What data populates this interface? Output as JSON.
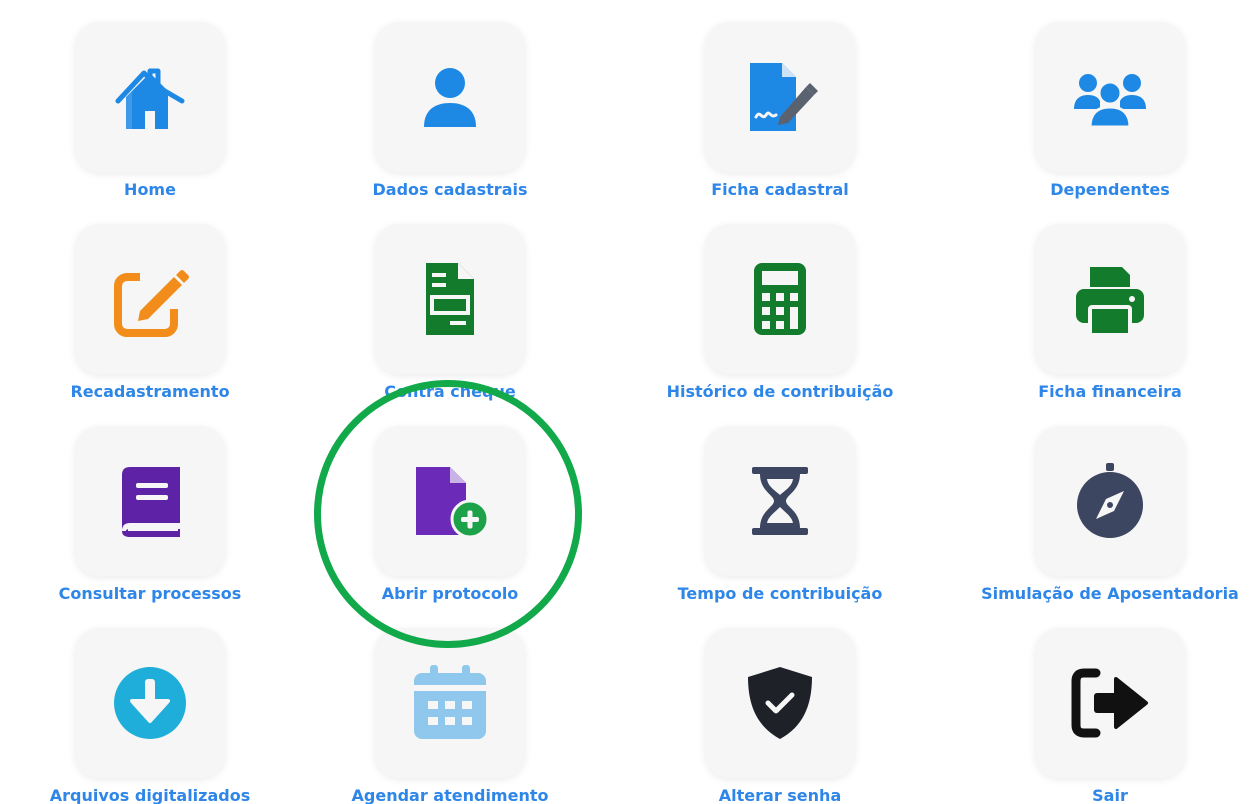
{
  "menu": {
    "items": [
      {
        "label": "Home",
        "icon": "home-icon",
        "color": "#1e88e5"
      },
      {
        "label": "Dados cadastrais",
        "icon": "user-icon",
        "color": "#1e88e5"
      },
      {
        "label": "Ficha cadastral",
        "icon": "document-signature-icon",
        "color": "#1e88e5"
      },
      {
        "label": "Dependentes",
        "icon": "users-group-icon",
        "color": "#1e88e5"
      },
      {
        "label": "Recadastramento",
        "icon": "edit-icon",
        "color": "#f28c1a"
      },
      {
        "label": "Contra cheque",
        "icon": "file-invoice-icon",
        "color": "#137c2c"
      },
      {
        "label": "Histórico de contribuição",
        "icon": "calculator-icon",
        "color": "#137c2c"
      },
      {
        "label": "Ficha financeira",
        "icon": "printer-icon",
        "color": "#137c2c"
      },
      {
        "label": "Consultar processos",
        "icon": "book-icon",
        "color": "#5e22a6"
      },
      {
        "label": "Abrir protocolo",
        "icon": "file-add-icon",
        "color": "#6c2ab8"
      },
      {
        "label": "Tempo de contribuição",
        "icon": "hourglass-icon",
        "color": "#3d4660"
      },
      {
        "label": "Simulação de Aposentadoria",
        "icon": "compass-icon",
        "color": "#3d4660"
      },
      {
        "label": "Arquivos digitalizados",
        "icon": "download-circle-icon",
        "color": "#1eaed9"
      },
      {
        "label": "Agendar atendimento",
        "icon": "calendar-icon",
        "color": "#8fc8ec"
      },
      {
        "label": "Alterar senha",
        "icon": "shield-check-icon",
        "color": "#1e2128"
      },
      {
        "label": "Sair",
        "icon": "sign-out-icon",
        "color": "#111111"
      }
    ]
  },
  "highlight": {
    "target": "Abrir protocolo",
    "color": "#12a94a"
  }
}
